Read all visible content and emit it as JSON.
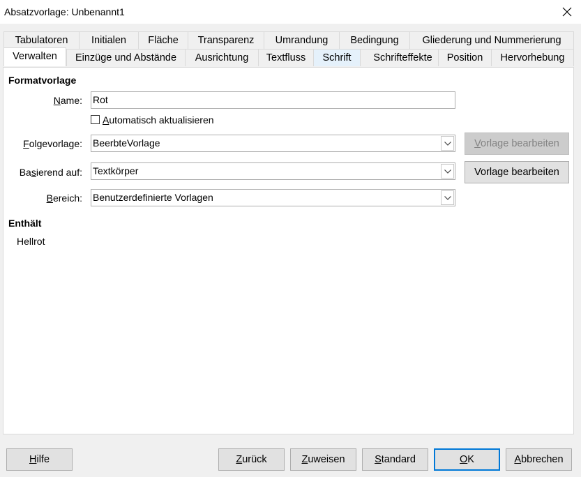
{
  "window": {
    "title": "Absatzvorlage: Unbenannt1"
  },
  "tabs_row1": [
    "Tabulatoren",
    "Initialen",
    "Fläche",
    "Transparenz",
    "Umrandung",
    "Bedingung",
    "Gliederung und Nummerierung"
  ],
  "tabs_row2": [
    "Verwalten",
    "Einzüge und Abstände",
    "Ausrichtung",
    "Textfluss",
    "Schrift",
    "Schrifteffekte",
    "Position",
    "Hervorhebung"
  ],
  "active_tab": "Verwalten",
  "hover_tab": "Schrift",
  "formatvorlage": {
    "heading": "Formatvorlage",
    "name_label_u": "N",
    "name_label_rest": "ame:",
    "name_value": "Rot",
    "auto_update_u": "A",
    "auto_update_rest": "utomatisch aktualisieren",
    "auto_update_checked": false,
    "next_label_u": "F",
    "next_label_rest": "olgevorlage:",
    "next_value": "BeerbteVorlage",
    "based_label_pre": "Ba",
    "based_label_u": "s",
    "based_label_post": "ierend auf:",
    "based_value": "Textkörper",
    "area_label_u": "B",
    "area_label_rest": "ereich:",
    "area_value": "Benutzerdefinierte Vorlagen",
    "edit_next_pre": "",
    "edit_next_u": "V",
    "edit_next_post": "orlage bearbeiten",
    "edit_based_pre": "Vorla",
    "edit_based_u": "g",
    "edit_based_post": "e bearbeiten"
  },
  "contains": {
    "heading": "Enthält",
    "value": "Hellrot"
  },
  "footer": {
    "help_u": "H",
    "help_rest": "ilfe",
    "back_u": "Z",
    "back_rest": "urück",
    "assign_u": "Z",
    "assign_rest": "uweisen",
    "standard_u": "S",
    "standard_rest": "tandard",
    "ok_u": "O",
    "ok_rest": "K",
    "cancel_u": "A",
    "cancel_rest": "bbrechen"
  },
  "colors": {
    "accent": "#0078d7",
    "hover_tab": "#e5f1fb",
    "disabled_button": "#cccccc"
  }
}
